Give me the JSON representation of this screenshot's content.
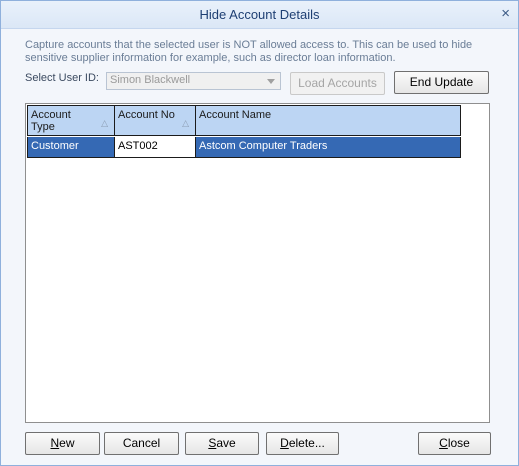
{
  "window": {
    "title": "Hide Account Details",
    "close_glyph": "×"
  },
  "description": {
    "line1": "Capture accounts that the selected user is NOT allowed access to. This can be used to hide",
    "line2": "sensitive supplier information for example, such as director loan information."
  },
  "user_selector": {
    "label": "Select User ID:",
    "value": "Simon Blackwell",
    "disabled": true
  },
  "toolbar": {
    "load_accounts": "Load Accounts",
    "end_update": "End Update"
  },
  "grid": {
    "columns": [
      {
        "label": "Account Type",
        "sortable": true
      },
      {
        "label": "Account No",
        "sortable": true
      },
      {
        "label": "Account Name",
        "sortable": false
      }
    ],
    "sort_glyph": "△",
    "rows": [
      {
        "account_type": "Customer",
        "account_no": "AST002",
        "account_name": "Astcom Computer Traders",
        "selected": true
      }
    ]
  },
  "footer": {
    "new_key": "N",
    "new_rest": "ew",
    "cancel": "Cancel",
    "save_key": "S",
    "save_rest": "ave",
    "delete_key": "D",
    "delete_rest": "elete...",
    "close_key": "C",
    "close_rest": "lose"
  },
  "colors": {
    "selection": "#3569b4",
    "header": "#bcd5f3",
    "title_text": "#1e3f73"
  }
}
